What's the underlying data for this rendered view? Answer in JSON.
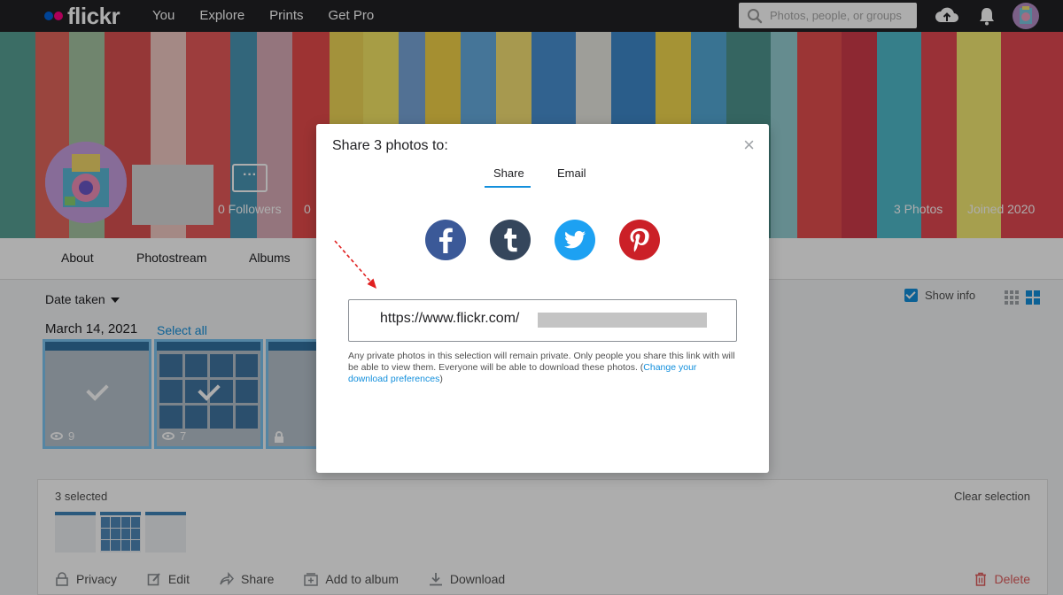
{
  "nav": {
    "logo": "flickr",
    "links": [
      "You",
      "Explore",
      "Prints",
      "Get Pro"
    ],
    "search_placeholder": "Photos, people, or groups",
    "icons": [
      "upload-icon",
      "notification-bell-icon",
      "user-avatar"
    ]
  },
  "profile": {
    "followers": "0 Followers",
    "following": "0",
    "photos": "3 Photos",
    "joined": "Joined 2020",
    "more_label": "···"
  },
  "subnav": [
    "About",
    "Photostream",
    "Albums"
  ],
  "toolbar": {
    "sort_label": "Date taken",
    "show_info": "Show info"
  },
  "photos": {
    "date": "March 14, 2021",
    "select_all": "Select all",
    "items": [
      {
        "views": "9",
        "selected": true
      },
      {
        "views": "7",
        "selected": true
      },
      {
        "views": "",
        "selected": true,
        "private": true
      }
    ]
  },
  "selection": {
    "count": "3 selected",
    "clear": "Clear selection",
    "actions": [
      "Privacy",
      "Edit",
      "Share",
      "Add to album",
      "Download"
    ],
    "delete": "Delete"
  },
  "modal": {
    "title": "Share 3 photos to:",
    "close": "×",
    "tabs": [
      "Share",
      "Email"
    ],
    "active_tab": "Share",
    "social": [
      "facebook-icon",
      "tumblr-icon",
      "twitter-icon",
      "pinterest-icon"
    ],
    "url_value": "https://www.flickr.com/",
    "note_text": "Any private photos in this selection will remain private. Only people you share this link with will be able to view them. Everyone will be able to download these photos. (",
    "note_link": "Change your download preferences",
    "note_end": ")"
  },
  "colors": {
    "accent": "#128fdc",
    "facebook": "#3b5998",
    "tumblr": "#35465c",
    "twitter": "#1da1f2",
    "pinterest": "#cb2027",
    "annotation_arrow": "#e02020"
  }
}
